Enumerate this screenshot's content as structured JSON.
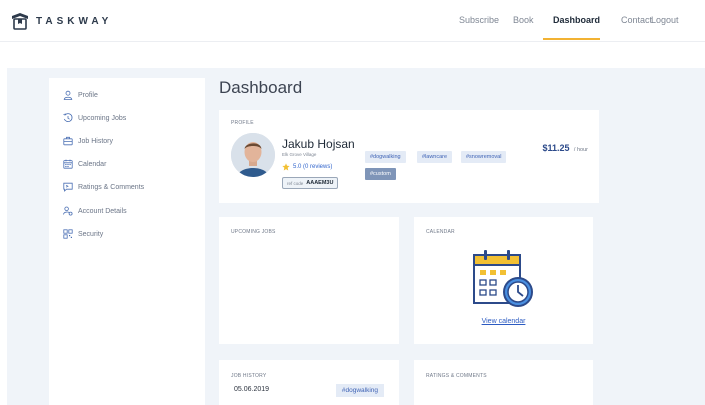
{
  "header": {
    "logo_text": "TASKWAY",
    "nav": [
      {
        "label": "Subscribe",
        "active": false
      },
      {
        "label": "Book",
        "active": false
      },
      {
        "label": "Dashboard",
        "active": true
      },
      {
        "label": "Contact",
        "active": false
      },
      {
        "label": "Logout",
        "active": false
      }
    ]
  },
  "sidebar": {
    "items": [
      {
        "label": "Profile",
        "icon": "user-icon"
      },
      {
        "label": "Upcoming Jobs",
        "icon": "clock-icon"
      },
      {
        "label": "Job History",
        "icon": "briefcase-icon"
      },
      {
        "label": "Calendar",
        "icon": "calendar-icon"
      },
      {
        "label": "Ratings & Comments",
        "icon": "comment-icon"
      },
      {
        "label": "Account Details",
        "icon": "account-icon"
      },
      {
        "label": "Security",
        "icon": "qr-icon"
      }
    ]
  },
  "main": {
    "title": "Dashboard",
    "profile": {
      "section_label": "PROFILE",
      "name": "Jakub Hojsan",
      "location": "Elk Grove Village",
      "rating": "5.0 (0 reviews)",
      "ref_label": "ref code",
      "ref_code": "AAAEM3U",
      "tags": [
        "#dogwalking",
        "#lawncare",
        "#snowremoval"
      ],
      "custom_tag": "#custom",
      "price": "$11.25",
      "price_unit": "/ hour"
    },
    "upcoming_jobs": {
      "section_label": "UPCOMING JOBS"
    },
    "calendar": {
      "section_label": "CALENDAR",
      "link": "View calendar"
    },
    "job_history": {
      "section_label": "JOB HISTORY",
      "rows": [
        {
          "date": "05.06.2019",
          "tag": "#dogwalking"
        }
      ]
    },
    "ratings": {
      "section_label": "RATINGS & COMMENTS"
    }
  },
  "colors": {
    "accent": "#f2b233",
    "brand_dark": "#2d3a4b",
    "page_bg": "#f0f4f9",
    "link": "#2c5bc2",
    "tag_bg": "#e4ebf6",
    "tag_custom_bg": "#7f95b8"
  }
}
